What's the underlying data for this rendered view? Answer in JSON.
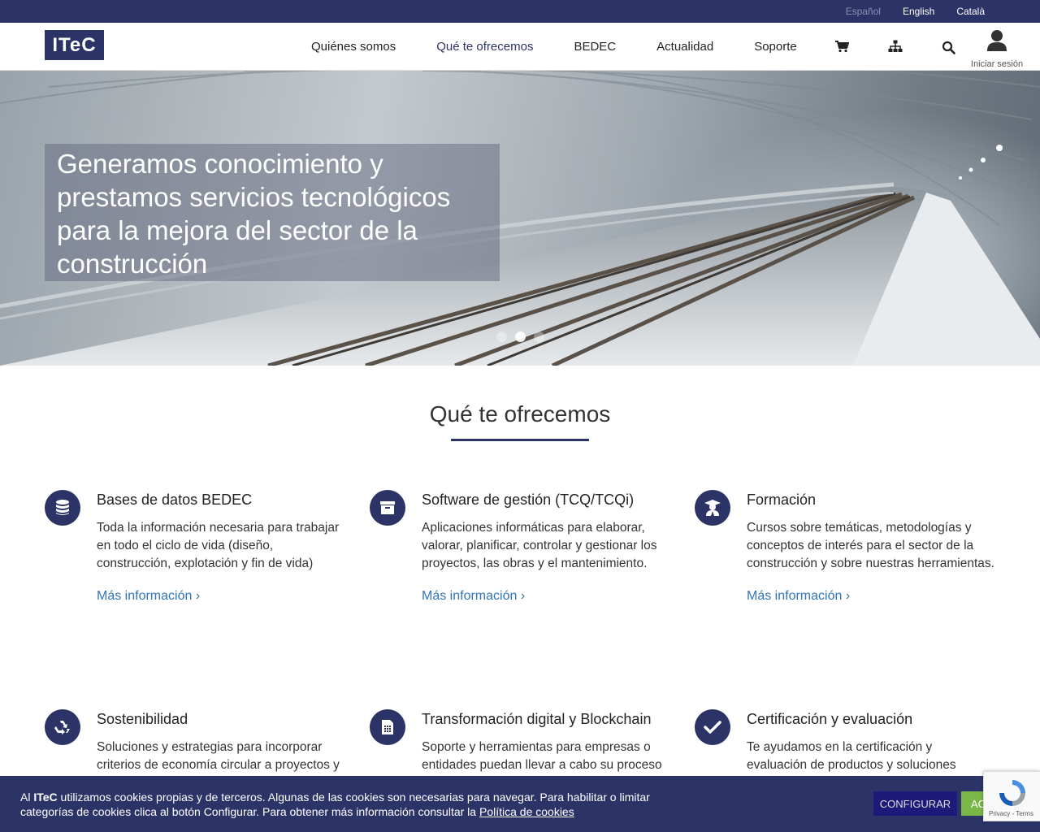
{
  "languages": [
    {
      "label": "Español",
      "active": true
    },
    {
      "label": "English",
      "active": false
    },
    {
      "label": "Català",
      "active": false
    }
  ],
  "logo": "ITeC",
  "nav": [
    {
      "label": "Quiénes somos"
    },
    {
      "label": "Qué te ofrecemos"
    },
    {
      "label": "BEDEC"
    },
    {
      "label": "Actualidad"
    },
    {
      "label": "Soporte"
    }
  ],
  "header_icons": [
    "cart-icon",
    "sitemap-icon",
    "search-icon",
    "user-icon"
  ],
  "login_label": "Iniciar sesión",
  "hero": {
    "caption": "Generamos conocimiento y prestamos servicios tecnológicos para la mejora del sector de la construcción",
    "slides": 3,
    "active_slide": 2
  },
  "section": {
    "title": "Qué te ofrecemos"
  },
  "cards": [
    {
      "icon": "database-icon",
      "title": "Bases de datos BEDEC",
      "text": "Toda la información necesaria para trabajar en todo el ciclo de vida (diseño, construcción, explotación y fin de vida)",
      "link": "Más información ›"
    },
    {
      "icon": "archive-icon",
      "title": "Software de gestión (TCQ/TCQi)",
      "text": "Aplicaciones informáticas para elaborar, valorar, planificar, controlar y gestionar los proyectos, las obras y el mantenimiento.",
      "link": "Más información ›"
    },
    {
      "icon": "graduate-icon",
      "title": "Formación",
      "text": "Cursos sobre temáticas, metodologías y conceptos de interés para el sector de la construcción y sobre nuestras herramientas.",
      "link": "Más información ›"
    },
    {
      "icon": "recycle-icon",
      "title": "Sostenibilidad",
      "text": "Soluciones y estrategias para incorporar criterios de economía circular a proyectos y",
      "link": ""
    },
    {
      "icon": "calculator-icon",
      "title": "Transformación digital y Blockchain",
      "text": "Soporte y herramientas para empresas o entidades puedan llevar a cabo su proceso",
      "link": ""
    },
    {
      "icon": "check-icon",
      "title": "Certificación y evaluación",
      "text": "Te ayudamos en la certificación y evaluación de productos y soluciones",
      "link": ""
    }
  ],
  "cookie": {
    "prefix": "Al ",
    "brand": "ITeC",
    "text": " utilizamos cookies propias y de terceros. Algunas de las cookies son necesarias para navegar. Para habilitar o limitar categorías de cookies clica al botón Configurar. Para obtener más información consultar la ",
    "link": "Política de cookies",
    "configure_label": "CONFIGURAR",
    "accept_label": "ACEPTAR"
  },
  "recaptcha": {
    "footer": "Privacy - Terms"
  },
  "colors": {
    "brand": "#2c3467",
    "link": "#2f75b8",
    "accept": "#7ab648"
  }
}
